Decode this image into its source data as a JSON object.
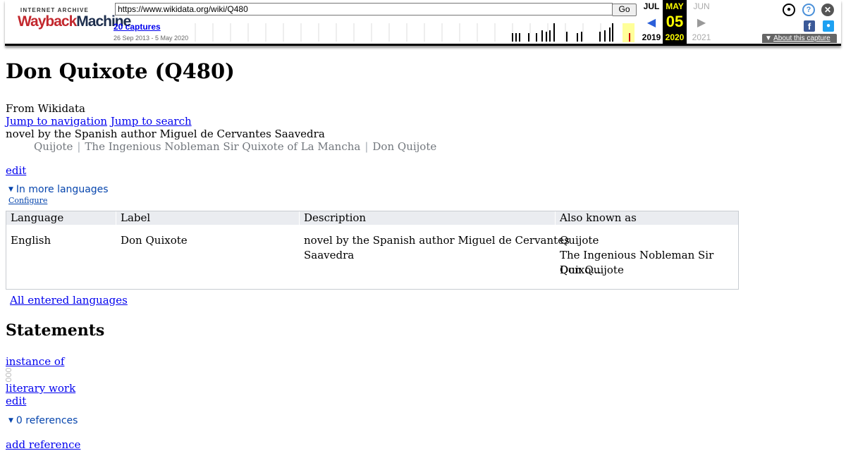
{
  "wayback": {
    "logo_top": "INTERNET ARCHIVE",
    "logo_wayback": "Wayback",
    "logo_machine": "Machine",
    "url_value": "https://www.wikidata.org/wiki/Q480",
    "go_label": "Go",
    "captures_label": "20 captures",
    "date_range": "26 Sep 2013 - 5 May 2020",
    "calendar": {
      "prev": {
        "month": "JUL",
        "year": "2019"
      },
      "current": {
        "month": "MAY",
        "day": "05",
        "year": "2020"
      },
      "next": {
        "month": "JUN",
        "year": "2021"
      }
    },
    "about_label": "About this capture",
    "icons": {
      "user": "user-icon",
      "help": "help-icon",
      "close": "close-icon",
      "facebook": "facebook-icon",
      "twitter": "twitter-icon"
    },
    "colors": {
      "highlight": "#ffff00",
      "nav_blue": "#2b5fd9"
    }
  },
  "item": {
    "title": "Don Quixote (Q480)",
    "from_label": "From Wikidata",
    "jump_navigation": "Jump to navigation",
    "jump_search": "Jump to search",
    "description": "novel by the Spanish author Miguel de Cervantes Saavedra",
    "aliases": [
      "Quijote",
      "The Ingenious Nobleman Sir Quixote of La Mancha",
      "Don Quijote"
    ],
    "alias_separator": "|",
    "edit_label": "edit"
  },
  "languages": {
    "toggle_label": "In more languages",
    "configure_label": "Configure",
    "headers": [
      "Language",
      "Label",
      "Description",
      "Also known as"
    ],
    "rows": [
      {
        "language": "English",
        "label": "Don Quixote",
        "description_line1": "novel by the Spanish author Miguel de Cervantes",
        "description_line2": "Saavedra",
        "aliases": [
          "Quijote",
          "The Ingenious Nobleman Sir Quixo…",
          "Don Quijote"
        ]
      }
    ],
    "all_languages_label": "All entered languages"
  },
  "statements": {
    "heading": "Statements",
    "property": "instance of",
    "value": "literary work",
    "edit_label": "edit",
    "references_label": "0 references",
    "add_reference": "add reference"
  }
}
